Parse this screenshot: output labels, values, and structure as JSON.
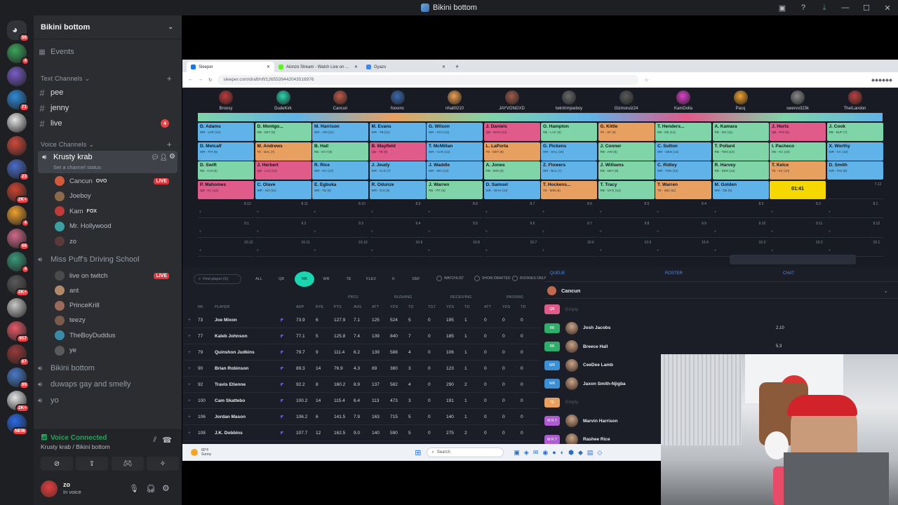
{
  "window": {
    "title": "Bikini bottom"
  },
  "servers": [
    {
      "badge": "56"
    },
    {
      "badge": "4"
    },
    {
      "badge": ""
    },
    {
      "badge": "71"
    },
    {
      "badge": ""
    },
    {
      "badge": ""
    },
    {
      "badge": "23"
    },
    {
      "badge": "2K+"
    },
    {
      "badge": "4"
    },
    {
      "badge": "68"
    },
    {
      "badge": "4"
    },
    {
      "badge": "2K+"
    },
    {
      "badge": ""
    },
    {
      "badge": "957"
    },
    {
      "badge": "67"
    },
    {
      "badge": "99"
    },
    {
      "badge": "2K+"
    },
    {
      "badge": "NEW"
    }
  ],
  "sidebar": {
    "server_name": "Bikini bottom",
    "events": "Events",
    "text_category": "Text Channels",
    "text_channels": [
      {
        "name": "pee",
        "count": ""
      },
      {
        "name": "jenny",
        "count": ""
      },
      {
        "name": "live",
        "count": "4"
      }
    ],
    "voice_category": "Voice Channels",
    "active_voice": {
      "name": "Krusty krab",
      "status": "Set a channel status"
    },
    "voice_users_1": [
      {
        "name": "Cancun",
        "extra": "OVO",
        "live": "LIVE"
      },
      {
        "name": "Joeboy",
        "extra": "",
        "live": ""
      },
      {
        "name": "Kam",
        "extra": "FOX",
        "live": ""
      },
      {
        "name": "Mr. Hollywood",
        "extra": "",
        "live": ""
      },
      {
        "name": "zo",
        "extra": "",
        "live": ""
      }
    ],
    "voice_channel_2": "Miss Puff's Driving School",
    "voice_users_2": [
      {
        "name": "live on twitch",
        "live": "LIVE"
      },
      {
        "name": "ant",
        "live": ""
      },
      {
        "name": "PrinceKrill",
        "live": ""
      },
      {
        "name": "teezy",
        "live": ""
      },
      {
        "name": "TheBoyDuddus",
        "live": ""
      },
      {
        "name": "ye",
        "live": ""
      }
    ],
    "other_voice": [
      "Bikini bottom",
      "duwaps gay and smelly",
      "yo"
    ]
  },
  "voice_panel": {
    "status": "Voice Connected",
    "location": "Krusty krab / Bikini bottom"
  },
  "user_panel": {
    "name": "zo",
    "status": "In voice"
  },
  "browser": {
    "tabs": [
      "Sleeper",
      "Alonzo Stream - Watch Live on ...",
      "Gyazo"
    ],
    "url": "sleeper.com/draft/nfl/1265539442043518976"
  },
  "draft": {
    "managers": [
      "Broosy",
      "DudeKirk",
      "Cancun",
      "foosmc",
      "nhall0210",
      "JAYVONGXD",
      "twintrimjoeboy",
      "Gizmorulz24",
      "KamDolla",
      "Pacq",
      "swervo323k",
      "TheILandon"
    ],
    "rows": [
      [
        {
          "n": "D. Adams",
          "p": "WR - LVR (10)",
          "c": "#5fb3e8"
        },
        {
          "n": "D. Montgo...",
          "p": "RB - DET (5)",
          "c": "#7fd4a8"
        },
        {
          "n": "M. Harrison",
          "p": "WR - ARI (11)",
          "c": "#5fb3e8"
        },
        {
          "n": "M. Evans",
          "p": "WR - TB (11)",
          "c": "#5fb3e8"
        },
        {
          "n": "G. Wilson",
          "p": "WR - NYJ (12)",
          "c": "#5fb3e8"
        },
        {
          "n": "J. Daniels",
          "p": "QB - WAS (14)",
          "c": "#e05a8a"
        },
        {
          "n": "O. Hampton",
          "p": "RB - LAC (5)",
          "c": "#7fd4a8"
        },
        {
          "n": "G. Kittle",
          "p": "TE - SF (9)",
          "c": "#e8a060"
        },
        {
          "n": "T. Henders...",
          "p": "RB - NE (14)",
          "c": "#7fd4a8"
        },
        {
          "n": "A. Kamara",
          "p": "RB - NO (11)",
          "c": "#7fd4a8"
        },
        {
          "n": "J. Hurts",
          "p": "QB - PHI (5)",
          "c": "#e05a8a"
        },
        {
          "n": "J. Cook",
          "p": "RB - BUF (7)",
          "c": "#7fd4a8"
        }
      ],
      [
        {
          "n": "D. Metcalf",
          "p": "WR - PIT (5)",
          "c": "#5fb3e8"
        },
        {
          "n": "M. Andrews",
          "p": "TE - BAL (7)",
          "c": "#e8a060"
        },
        {
          "n": "B. Hall",
          "p": "RB - NYJ (9)",
          "c": "#7fd4a8"
        },
        {
          "n": "B. Mayfield",
          "p": "QB - TB (9)",
          "c": "#e05a8a"
        },
        {
          "n": "T. McMillan",
          "p": "WR - CAR (14)",
          "c": "#5fb3e8"
        },
        {
          "n": "L. LaPorta",
          "p": "TE - DET (8)",
          "c": "#e8a060"
        },
        {
          "n": "G. Pickens",
          "p": "WR - DAL (10)",
          "c": "#5fb3e8"
        },
        {
          "n": "J. Conner",
          "p": "RB - ARI (8)",
          "c": "#7fd4a8"
        },
        {
          "n": "C. Sutton",
          "p": "WR - DEN (12)",
          "c": "#5fb3e8"
        },
        {
          "n": "T. Pollard",
          "p": "RB - TEN (10)",
          "c": "#7fd4a8"
        },
        {
          "n": "I. Pacheco",
          "p": "RB - KC (10)",
          "c": "#7fd4a8"
        },
        {
          "n": "X. Worthy",
          "p": "WR - KC (10)",
          "c": "#5fb3e8"
        }
      ],
      [
        {
          "n": "D. Swift",
          "p": "RB - CHI (5)",
          "c": "#7fd4a8"
        },
        {
          "n": "J. Herbert",
          "p": "QB - LAC (12)",
          "c": "#e05a8a"
        },
        {
          "n": "R. Rice",
          "p": "WR - KC (10)",
          "c": "#5fb3e8"
        },
        {
          "n": "J. Jeudy",
          "p": "WR - CLE (7)",
          "c": "#5fb3e8"
        },
        {
          "n": "J. Waddle",
          "p": "WR - MIA (12)",
          "c": "#5fb3e8"
        },
        {
          "n": "A. Jones",
          "p": "RB - MIN (6)",
          "c": "#7fd4a8"
        },
        {
          "n": "Z. Flowers",
          "p": "WR - BAL (7)",
          "c": "#5fb3e8"
        },
        {
          "n": "J. Williams",
          "p": "RB - DET (8)",
          "c": "#7fd4a8"
        },
        {
          "n": "C. Ridley",
          "p": "WR - TEN (10)",
          "c": "#5fb3e8"
        },
        {
          "n": "R. Harvey",
          "p": "RB - DEN (12)",
          "c": "#7fd4a8"
        },
        {
          "n": "T. Kelce",
          "p": "TE - KC (10)",
          "c": "#e8a060"
        },
        {
          "n": "D. Smith",
          "p": "WR - PHI (9)",
          "c": "#5fb3e8"
        }
      ],
      [
        {
          "n": "P. Mahomes",
          "p": "QB - KC (10)",
          "c": "#e05a8a"
        },
        {
          "n": "C. Olave",
          "p": "WR - NO (11)",
          "c": "#5fb3e8"
        },
        {
          "n": "E. Egbuka",
          "p": "WR - TB (9)",
          "c": "#5fb3e8"
        },
        {
          "n": "R. Odunze",
          "p": "WR - CHI (5)",
          "c": "#5fb3e8"
        },
        {
          "n": "J. Warren",
          "p": "RB - PIT (5)",
          "c": "#7fd4a8"
        },
        {
          "n": "D. Samuel",
          "p": "WR - WAS (12)",
          "c": "#5fb3e8"
        },
        {
          "n": "T. Hockens...",
          "p": "TE - MIN (6)",
          "c": "#e8a060"
        },
        {
          "n": "T. Tracy",
          "p": "RB - NYG (14)",
          "c": "#7fd4a8"
        },
        {
          "n": "T. Warren",
          "p": "TE - IND (11)",
          "c": "#e8a060"
        },
        {
          "n": "M. Golden",
          "p": "WR - GB (5)",
          "c": "#5fb3e8"
        },
        {
          "n": "01:41",
          "p": "",
          "c": "#f5d800"
        },
        {
          "n": "",
          "p": "7.12",
          "c": ""
        }
      ]
    ],
    "empty_rows": [
      [
        "8.12",
        "8.11",
        "8.10",
        "8.9",
        "8.8",
        "8.7",
        "8.6",
        "8.5",
        "8.4",
        "8.3",
        "8.2",
        "8.1"
      ],
      [
        "9.1",
        "9.2",
        "9.3",
        "9.4",
        "9.5",
        "9.6",
        "9.7",
        "9.8",
        "9.9",
        "9.10",
        "9.11",
        "9.12"
      ],
      [
        "10.12",
        "10.11",
        "10.10",
        "10.9",
        "10.8",
        "10.7",
        "10.6",
        "10.5",
        "10.4",
        "10.3",
        "10.2",
        "10.1"
      ]
    ]
  },
  "players_panel": {
    "search_placeholder": "Find player (X)",
    "filters": [
      "ALL",
      "QB",
      "RB",
      "WR",
      "TE",
      "FLEX",
      "K",
      "DEF"
    ],
    "options": [
      "WATCHLIST",
      "SHOW DRAFTED",
      "ROOKIES ONLY"
    ],
    "groups": [
      "PROJ",
      "RUSHING",
      "RECEIVING",
      "PASSING"
    ],
    "headers": [
      "RK",
      "PLAYER",
      "ADP",
      "BYE",
      "PTS",
      "AVG",
      "ATT",
      "YDS",
      "TD",
      "TGT",
      "YDS",
      "TD",
      "ATT",
      "YDS",
      "TD"
    ],
    "rows": [
      {
        "rk": "73",
        "name": "Joe Mixon",
        "adp": "73.9",
        "bye": "6",
        "v": [
          "127.9",
          "7.1",
          "125",
          "524",
          "5",
          "0",
          "195",
          "1",
          "0",
          "0",
          "0"
        ]
      },
      {
        "rk": "77",
        "name": "Kaleb Johnson",
        "adp": "77.1",
        "bye": "5",
        "v": [
          "125.8",
          "7.4",
          "139",
          "840",
          "7",
          "0",
          "185",
          "1",
          "0",
          "0",
          "0"
        ]
      },
      {
        "rk": "79",
        "name": "Quinshon Judkins",
        "adp": "79.7",
        "bye": "9",
        "v": [
          "111.4",
          "6.2",
          "139",
          "588",
          "4",
          "0",
          "106",
          "1",
          "0",
          "0",
          "0"
        ]
      },
      {
        "rk": "90",
        "name": "Brian Robinson",
        "adp": "89.3",
        "bye": "14",
        "v": [
          "76.9",
          "4.3",
          "89",
          "380",
          "3",
          "0",
          "123",
          "1",
          "0",
          "0",
          "0"
        ]
      },
      {
        "rk": "92",
        "name": "Travis Etienne",
        "adp": "92.2",
        "bye": "8",
        "v": [
          "160.2",
          "8.9",
          "137",
          "582",
          "4",
          "0",
          "290",
          "2",
          "0",
          "0",
          "0"
        ]
      },
      {
        "rk": "100",
        "name": "Cam Skattebo",
        "adp": "100.2",
        "bye": "14",
        "v": [
          "115.4",
          "6.4",
          "113",
          "473",
          "3",
          "0",
          "191",
          "1",
          "0",
          "0",
          "0"
        ]
      },
      {
        "rk": "106",
        "name": "Jordan Mason",
        "adp": "106.2",
        "bye": "6",
        "v": [
          "141.5",
          "7.9",
          "163",
          "715",
          "5",
          "0",
          "140",
          "1",
          "0",
          "0",
          "0"
        ]
      },
      {
        "rk": "108",
        "name": "J.K. Dobbins",
        "adp": "107.7",
        "bye": "12",
        "v": [
          "162.5",
          "9.0",
          "140",
          "590",
          "5",
          "0",
          "275",
          "2",
          "0",
          "0",
          "0"
        ]
      }
    ]
  },
  "queue_panel": {
    "tabs": [
      "QUEUE",
      "ROSTER",
      "CHAT"
    ],
    "team": "Cancun",
    "slots": [
      {
        "pos": "QB",
        "name": "Empty",
        "pts": "",
        "c": "#e05a8a"
      },
      {
        "pos": "RB",
        "name": "Josh Jacobs",
        "pts": "2.10",
        "c": "#2fae6a"
      },
      {
        "pos": "RB",
        "name": "Breece Hall",
        "pts": "5.3",
        "c": "#2fae6a"
      },
      {
        "pos": "WR",
        "name": "CeeDee Lamb",
        "pts": "",
        "c": "#3a8fd6"
      },
      {
        "pos": "WR",
        "name": "Jaxon Smith-Njigba",
        "pts": "",
        "c": "#3a8fd6"
      },
      {
        "pos": "TE",
        "name": "Empty",
        "pts": "",
        "c": "#e8a060"
      },
      {
        "pos": "W R T",
        "name": "Marvin Harrison",
        "pts": "",
        "c": "#b05ad6"
      },
      {
        "pos": "W R T",
        "name": "Rashee Rice",
        "pts": "",
        "c": "#b05ad6"
      }
    ]
  },
  "taskbar": {
    "weather_temp": "80°F",
    "weather_desc": "Sunny",
    "search": "Search"
  },
  "colors": {
    "accent_green": "#23a55a",
    "live_red": "#da373c",
    "timer_yellow": "#f5d800"
  }
}
